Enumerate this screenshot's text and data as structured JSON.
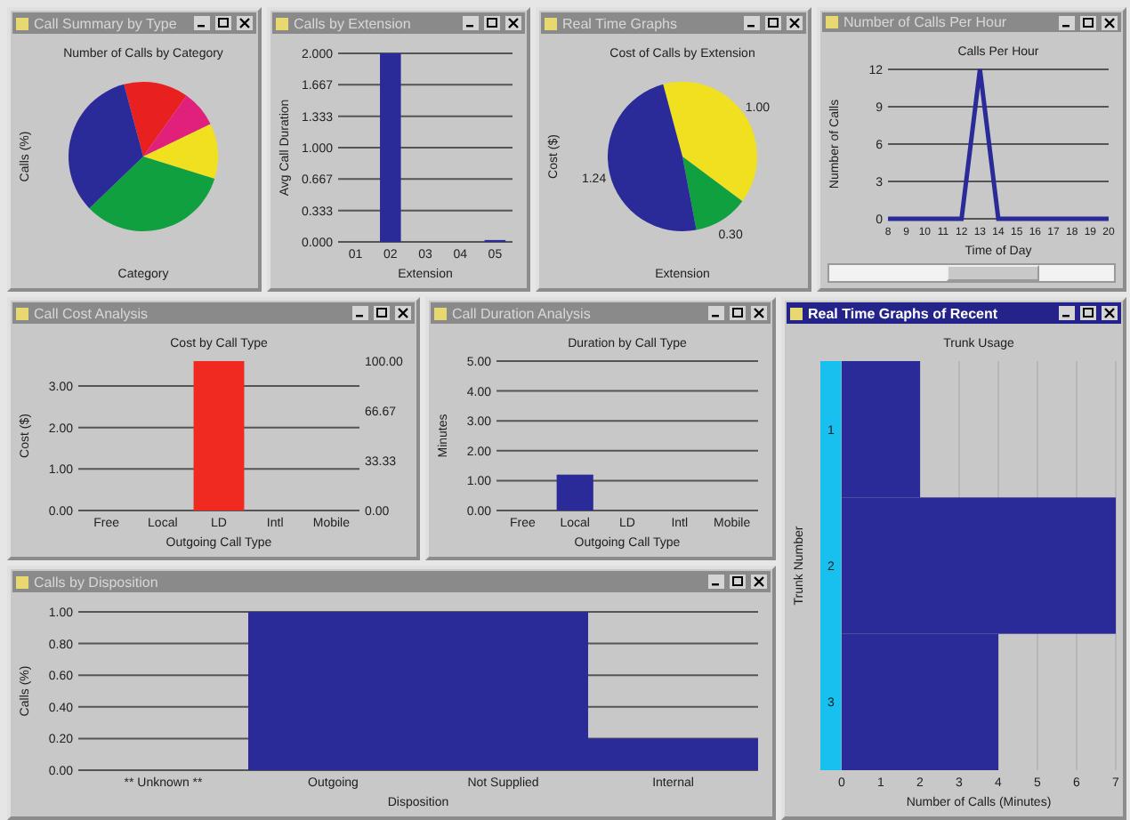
{
  "windows": [
    {
      "title": "Call Summary by Type",
      "active": false,
      "chart_data": {
        "type": "pie",
        "title": "Number of Calls by Category",
        "ylabel": "Calls (%)",
        "xlabel": "Category",
        "values": [
          14,
          8,
          12,
          33,
          33
        ],
        "colors": [
          "#e82020",
          "#e0207a",
          "#f0e020",
          "#10a040",
          "#2a2a98"
        ]
      }
    },
    {
      "title": "Calls by Extension",
      "active": false,
      "chart_data": {
        "type": "bar",
        "ylabel": "Avg Call Duration",
        "xlabel": "Extension",
        "categories": [
          "01",
          "02",
          "03",
          "04",
          "05"
        ],
        "grid": true,
        "series": [
          {
            "color": "#2a2a98",
            "values": [
              0,
              2,
              0,
              0,
              0.02
            ]
          }
        ],
        "ylim": [
          0,
          2
        ],
        "yticks": [
          {
            "value": 0,
            "label": "0.000"
          },
          {
            "value": 0.333,
            "label": "0.333"
          },
          {
            "value": 0.667,
            "label": "0.667"
          },
          {
            "value": 1,
            "label": "1.000"
          },
          {
            "value": 1.333,
            "label": "1.333"
          },
          {
            "value": 1.667,
            "label": "1.667"
          },
          {
            "value": 2,
            "label": "2.000"
          }
        ]
      }
    },
    {
      "title": "Real Time Graphs",
      "active": false,
      "chart_data": {
        "type": "pie",
        "title": "Cost of Calls by Extension",
        "ylabel": "Cost ($)",
        "xlabel": "Extension",
        "values": [
          1.0,
          0.3,
          1.24
        ],
        "colors": [
          "#f0e020",
          "#10a040",
          "#2a2a98"
        ],
        "value_labels": [
          "1.00",
          "0.30",
          "1.24"
        ]
      }
    },
    {
      "title": "Number of Calls Per Hour",
      "active": false,
      "chart_data": {
        "type": "line",
        "title": "Calls Per Hour",
        "ylabel": "Number of Calls",
        "xlabel": "Time of Day",
        "x": [
          8,
          9,
          10,
          11,
          12,
          13,
          14,
          15,
          16,
          17,
          18,
          19,
          20
        ],
        "grid": true,
        "series": [
          {
            "color": "#2a2a98",
            "values": [
              0,
              0,
              0,
              0,
              0,
              12,
              0,
              0,
              0,
              0,
              0,
              0,
              0
            ]
          }
        ],
        "xlim": [
          8,
          20
        ],
        "ylim": [
          0,
          12
        ],
        "yticks": [
          0,
          3,
          6,
          9,
          12
        ],
        "xticks": [
          8,
          9,
          10,
          11,
          12,
          13,
          14,
          15,
          16,
          17,
          18,
          19,
          20
        ]
      }
    },
    {
      "title": "Call Cost Analysis",
      "active": false,
      "chart_data": {
        "type": "bar",
        "title": "Cost by Call Type",
        "ylabel": "Cost ($)",
        "xlabel": "Outgoing Call Type",
        "categories": [
          "Free",
          "Local",
          "LD",
          "Intl",
          "Mobile"
        ],
        "grid": true,
        "series": [
          {
            "color": "#f02a20",
            "values": [
              0,
              0,
              3.6,
              0,
              0
            ]
          }
        ],
        "ylim": [
          0,
          3.6
        ],
        "yticks": [
          {
            "value": 0,
            "label": "0.00"
          },
          {
            "value": 1,
            "label": "1.00"
          },
          {
            "value": 2,
            "label": "2.00"
          },
          {
            "value": 3,
            "label": "3.00"
          }
        ],
        "y2lim": [
          0,
          100
        ],
        "y2ticks": [
          {
            "value": 0,
            "label": "0.00"
          },
          {
            "value": 33.33,
            "label": "33.33"
          },
          {
            "value": 66.67,
            "label": "66.67"
          },
          {
            "value": 100,
            "label": "100.00"
          }
        ]
      }
    },
    {
      "title": "Call Duration Analysis",
      "active": false,
      "chart_data": {
        "type": "bar",
        "title": "Duration by Call Type",
        "ylabel": "Minutes",
        "xlabel": "Outgoing Call Type",
        "categories": [
          "Free",
          "Local",
          "LD",
          "Intl",
          "Mobile"
        ],
        "grid": true,
        "series": [
          {
            "color": "#2a2a98",
            "values": [
              0,
              1.2,
              0,
              0,
              0
            ]
          }
        ],
        "ylim": [
          0,
          5
        ],
        "yticks": [
          {
            "value": 0,
            "label": "0.00"
          },
          {
            "value": 1,
            "label": "1.00"
          },
          {
            "value": 2,
            "label": "2.00"
          },
          {
            "value": 3,
            "label": "3.00"
          },
          {
            "value": 4,
            "label": "4.00"
          },
          {
            "value": 5,
            "label": "5.00"
          }
        ]
      }
    },
    {
      "title": "Calls by Disposition",
      "active": false,
      "chart_data": {
        "type": "bar",
        "ylabel": "Calls (%)",
        "xlabel": "Disposition",
        "categories": [
          "** Unknown **",
          "Outgoing",
          "Not Supplied",
          "Internal"
        ],
        "grid": true,
        "series": [
          {
            "color": "#2a2a98",
            "values": [
              0,
              1,
              1,
              0.2
            ]
          }
        ],
        "ylim": [
          0,
          1
        ],
        "yticks": [
          {
            "value": 0,
            "label": "0.00"
          },
          {
            "value": 0.2,
            "label": "0.20"
          },
          {
            "value": 0.4,
            "label": "0.40"
          },
          {
            "value": 0.6,
            "label": "0.60"
          },
          {
            "value": 0.8,
            "label": "0.80"
          },
          {
            "value": 1,
            "label": "1.00"
          }
        ]
      }
    },
    {
      "title": "Real Time Graphs of Recent",
      "active": true,
      "chart_data": {
        "type": "bar",
        "orientation": "horizontal",
        "title": "Trunk Usage",
        "ylabel": "Trunk Number",
        "xlabel": "Number of Calls (Minutes)",
        "categories": [
          "1",
          "2",
          "3"
        ],
        "grid": true,
        "series": [
          {
            "color": "#2a2a98",
            "values": [
              2,
              7,
              4
            ]
          }
        ],
        "xlim": [
          0,
          7
        ],
        "xticks": [
          0,
          1,
          2,
          3,
          4,
          5,
          6,
          7
        ]
      }
    }
  ]
}
